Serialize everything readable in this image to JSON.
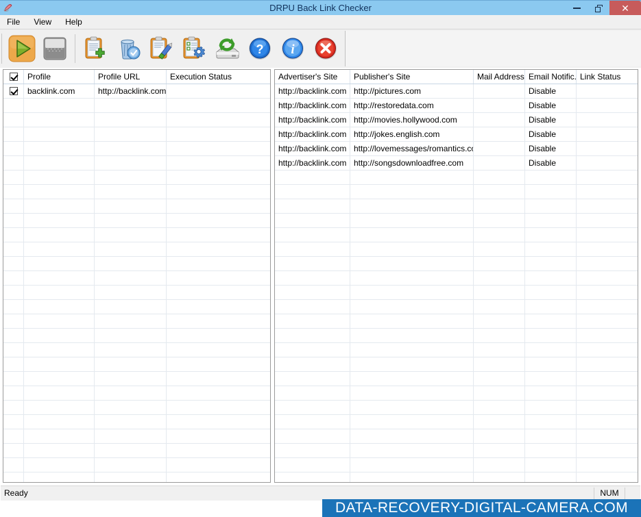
{
  "window": {
    "title": "DRPU Back Link Checker",
    "app_icon": "app-logo-icon",
    "minimize_label": "–",
    "maximize_label": "□",
    "close_label": "✕"
  },
  "menu": {
    "items": [
      {
        "label": "File"
      },
      {
        "label": "View"
      },
      {
        "label": "Help"
      }
    ]
  },
  "toolbar": {
    "buttons": [
      {
        "name": "start-button",
        "icon": "play-triangle-icon",
        "label": "Start"
      },
      {
        "name": "stop-button",
        "icon": "stop-square-icon",
        "label": "Stop"
      },
      {
        "name": "add-profile-button",
        "icon": "clipboard-plus-icon",
        "label": "Add Profile"
      },
      {
        "name": "delete-profile-button",
        "icon": "trash-check-icon",
        "label": "Delete Profile"
      },
      {
        "name": "edit-profile-button",
        "icon": "clipboard-pencil-icon",
        "label": "Edit Profile"
      },
      {
        "name": "settings-button",
        "icon": "clipboard-gear-icon",
        "label": "Settings"
      },
      {
        "name": "refresh-button",
        "icon": "drive-refresh-icon",
        "label": "Refresh"
      },
      {
        "name": "help-button",
        "icon": "help-question-icon",
        "label": "Help"
      },
      {
        "name": "about-button",
        "icon": "info-icon",
        "label": "About"
      },
      {
        "name": "exit-button",
        "icon": "close-x-circle-icon",
        "label": "Exit"
      }
    ]
  },
  "profiles_grid": {
    "header_checkbox_checked": true,
    "columns": [
      "",
      "Profile",
      "Profile URL",
      "Execution Status"
    ],
    "rows": [
      {
        "checked": true,
        "profile": "backlink.com",
        "profile_url": "http://backlink.com",
        "execution_status": ""
      }
    ],
    "empty_row_count": 27
  },
  "links_grid": {
    "columns": [
      "Advertiser's Site",
      "Publisher's Site",
      "Mail Address",
      "Email Notific...",
      "Link Status"
    ],
    "rows": [
      {
        "advertiser": "http://backlink.com",
        "publisher": "http://pictures.com",
        "mail_address": "",
        "email_notification": "Disable",
        "link_status": ""
      },
      {
        "advertiser": "http://backlink.com",
        "publisher": "http://restoredata.com",
        "mail_address": "",
        "email_notification": "Disable",
        "link_status": ""
      },
      {
        "advertiser": "http://backlink.com",
        "publisher": "http://movies.hollywood.com",
        "mail_address": "",
        "email_notification": "Disable",
        "link_status": ""
      },
      {
        "advertiser": "http://backlink.com",
        "publisher": "http://jokes.english.com",
        "mail_address": "",
        "email_notification": "Disable",
        "link_status": ""
      },
      {
        "advertiser": "http://backlink.com",
        "publisher": "http://lovemessages/romantics.com",
        "mail_address": "",
        "email_notification": "Disable",
        "link_status": ""
      },
      {
        "advertiser": "http://backlink.com",
        "publisher": "http://songsdownloadfree.com",
        "mail_address": "",
        "email_notification": "Disable",
        "link_status": ""
      }
    ],
    "empty_row_count": 22
  },
  "statusbar": {
    "message": "Ready",
    "num_indicator": "NUM"
  },
  "watermark": {
    "text": "DATA-RECOVERY-DIGITAL-CAMERA.COM"
  },
  "colors": {
    "titlebar": "#8bc9f0",
    "close_button": "#c75b5b",
    "watermark_bg": "#1b73b8",
    "toolbar_bg": "#f0f0f0"
  }
}
